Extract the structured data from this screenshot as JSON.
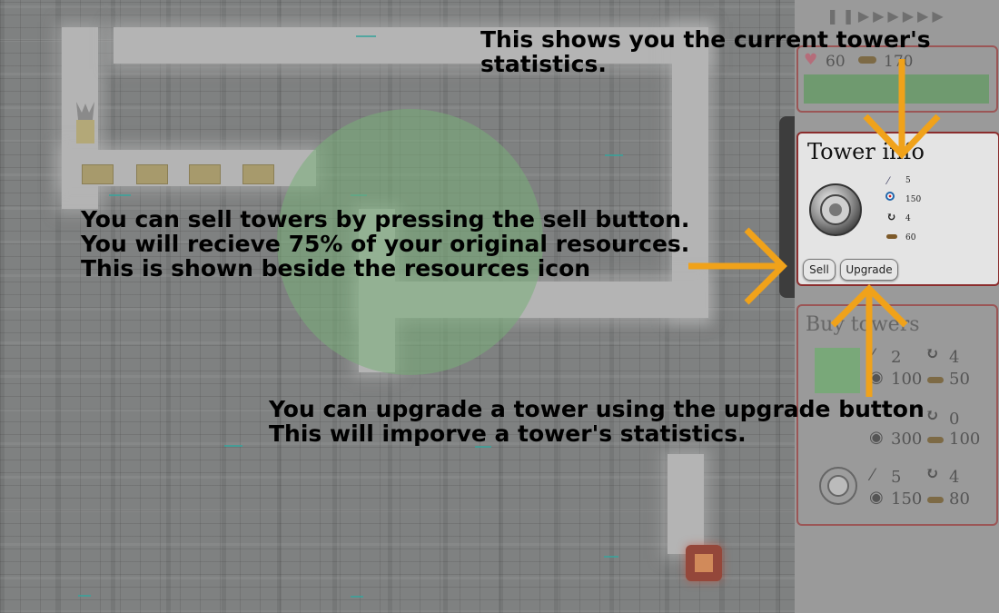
{
  "speed_controls": [
    "pause-icon",
    "play-icon",
    "fast-forward-icon",
    "faster-icon",
    "fastest-icon"
  ],
  "stats": {
    "lives": "60",
    "resources": "170"
  },
  "tower_info": {
    "title": "Tower info",
    "damage": "5",
    "range": "150",
    "rate": "4",
    "cost": "60",
    "sell_label": "Sell",
    "upgrade_label": "Upgrade"
  },
  "buy_towers": {
    "title": "Buy towers",
    "towers": [
      {
        "damage": "2",
        "rate": "4",
        "range": "100",
        "cost": "50"
      },
      {
        "rate": "0",
        "range": "300",
        "cost": "100"
      },
      {
        "damage": "5",
        "rate": "4",
        "range": "150",
        "cost": "80"
      }
    ]
  },
  "tutorial": {
    "stats_caption": "This shows you the current tower's\nstatistics.",
    "sell_caption": "You can sell towers by pressing the sell button.\nYou will recieve 75% of your original resources.\nThis is shown beside the resources icon",
    "upgrade_caption": "You can upgrade a tower using the upgrade button\nThis will imporve a tower's statistics."
  },
  "colors": {
    "arrow": "#f0a21a",
    "panel_border": "#8b2d2d",
    "range_circle": "#78af78"
  }
}
